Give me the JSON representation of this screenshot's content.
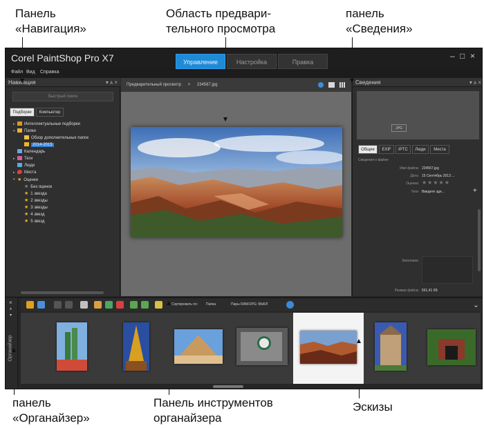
{
  "callouts": {
    "nav_panel": [
      "Панель",
      "«Навигация»"
    ],
    "preview_area": [
      "Область предвари-",
      "тельного просмотра"
    ],
    "info_panel": [
      "панель",
      "«Сведения»"
    ],
    "organizer_panel": [
      "панель",
      "«Органайзер»"
    ],
    "organizer_toolbar": [
      "Панель инструментов",
      "органайзера"
    ],
    "thumbnails": "Эскизы"
  },
  "app": {
    "title": "Corel PaintShop Pro X7",
    "tabs": [
      "Управление",
      "Настройка",
      "Правка"
    ],
    "active_tab": "Управление",
    "window_controls": [
      "–",
      "□",
      "×"
    ],
    "menu": [
      "Файл",
      "Вид",
      "Справка"
    ]
  },
  "navigation": {
    "title": "Навигация",
    "header_controls": "▾  ᴀ  ×",
    "search_placeholder": "Быстрый поиск",
    "subtabs": [
      "Подборки",
      "Компьютер"
    ],
    "active_subtab": "Подборки",
    "tree": [
      {
        "label": "Интеллектуальные подборки",
        "level": 1,
        "icon": "smart-collections-icon"
      },
      {
        "label": "Папки",
        "level": 1,
        "icon": "folder-icon"
      },
      {
        "label": "Обзор дополнительных папок",
        "level": 2,
        "icon": "browse-folder-icon"
      },
      {
        "label": "2014-2015",
        "level": 2,
        "icon": "folder-icon",
        "selected": true
      },
      {
        "label": "Календарь",
        "level": 1,
        "icon": "calendar-icon"
      },
      {
        "label": "Теги",
        "level": 1,
        "icon": "tag-icon"
      },
      {
        "label": "Люди",
        "level": 1,
        "icon": "people-icon"
      },
      {
        "label": "Места",
        "level": 1,
        "icon": "location-pin-icon"
      },
      {
        "label": "Оценки",
        "level": 1,
        "icon": "star-icon"
      },
      {
        "label": "Без оценок",
        "level": 2,
        "icon": "star-empty-icon"
      },
      {
        "label": "1 звезда",
        "level": 2,
        "icon": "star-icon"
      },
      {
        "label": "2 звезды",
        "level": 2,
        "icon": "star-icon"
      },
      {
        "label": "3 звезды",
        "level": 2,
        "icon": "star-icon"
      },
      {
        "label": "4 звезд",
        "level": 2,
        "icon": "star-icon"
      },
      {
        "label": "5 звезд",
        "level": 2,
        "icon": "star-icon"
      }
    ]
  },
  "preview": {
    "breadcrumb_label": "Предварительный просмотр",
    "breadcrumb_sep": ">",
    "file_name": "234567.jpg"
  },
  "info": {
    "title": "Сведения",
    "header_controls": "▾  ᴀ  ×",
    "badge": "JPG",
    "tabs": [
      "Общие",
      "EXIF",
      "IPTC",
      "Люди",
      "Места"
    ],
    "active_tab": "Общие",
    "section_title": "Сведения о файле",
    "fields": [
      {
        "label": "Имя файла:",
        "value": "234567.jpg"
      },
      {
        "label": "Дата:",
        "value": "15 Сентябрь 2013 ..."
      },
      {
        "label": "Оценка:",
        "value": "★★★★★"
      },
      {
        "label": "Теги:",
        "value": "Введите зде..."
      }
    ],
    "caption_label": "Заголовок:",
    "filesize_label": "Размер файла:",
    "filesize_value": "551,41 КБ",
    "add_tag": "+"
  },
  "organizer": {
    "side_label": "Органайзер",
    "side_controls": [
      "×",
      "ᴀ",
      "▾"
    ],
    "sort_label": "Сортировать по:",
    "sort_value": "Папка",
    "raw_label": "Пары RAW/JPG: ВЫКЛ",
    "collapse": "⌄"
  },
  "colors": {
    "accent": "#1f8ad6",
    "window_bg": "#2b2b2b",
    "preview_bg": "#6c6c6c"
  }
}
